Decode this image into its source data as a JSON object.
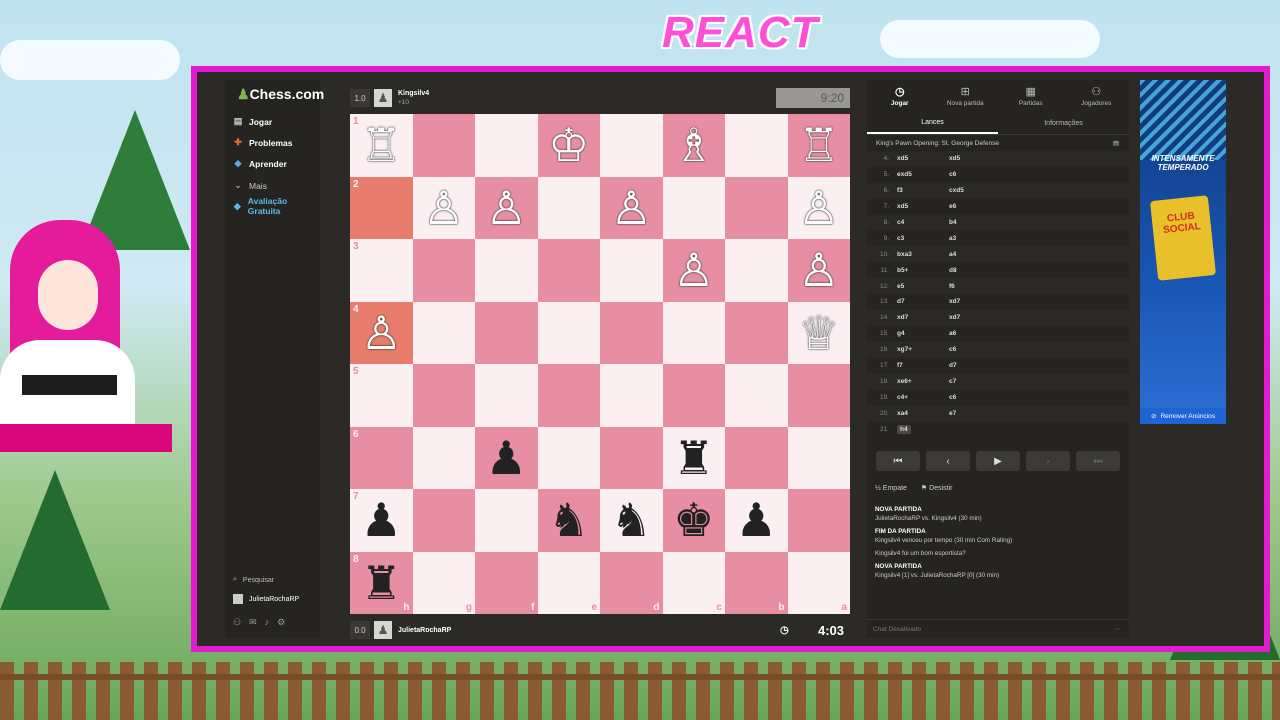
{
  "overlay": {
    "title": "REACT"
  },
  "nav": {
    "logo": "Chess.com",
    "items": [
      {
        "label": "Jogar",
        "icon": "play-icon"
      },
      {
        "label": "Problemas",
        "icon": "puzzle-icon"
      },
      {
        "label": "Aprender",
        "icon": "learn-icon"
      },
      {
        "label": "Mais",
        "icon": "chevron-down-icon"
      },
      {
        "label": "Avaliação Gratuita",
        "icon": "diamond-icon"
      }
    ],
    "search": "Pesquisar",
    "user": "JulietaRochaRP"
  },
  "top_player": {
    "score": "1.0",
    "name": "Kingsilv4",
    "sub": "+10",
    "clock": "9:20"
  },
  "bottom_player": {
    "score": "0.0",
    "name": "JulietaRochaRP",
    "clock": "4:03"
  },
  "board": {
    "ranks": [
      "1",
      "2",
      "3",
      "4",
      "5",
      "6",
      "7",
      "8"
    ],
    "files": [
      "h",
      "g",
      "f",
      "e",
      "d",
      "c",
      "b",
      "a"
    ],
    "pieces": {
      "0": {
        "0": "♖w",
        "3": "♔w",
        "5": "♗w",
        "7": "♖w"
      },
      "1": {
        "1": "♙w",
        "2": "♙w",
        "4": "♙w",
        "7": "♙w"
      },
      "2": {
        "5": "♙w",
        "7": "♙w"
      },
      "3": {
        "0": "♙w",
        "7": "♕w"
      },
      "5": {
        "2": "♟b",
        "5": "♜b"
      },
      "6": {
        "0": "♟b",
        "3": "♞b",
        "4": "♞b",
        "5": "♚b",
        "6": "♟b"
      },
      "7": {
        "0": "♜b"
      }
    },
    "highlights": [
      "1-0",
      "3-0"
    ]
  },
  "right": {
    "tabs": [
      {
        "label": "Jogar",
        "icon": "clock-icon"
      },
      {
        "label": "Nova partida",
        "icon": "plus-icon"
      },
      {
        "label": "Partidas",
        "icon": "board-icon"
      },
      {
        "label": "Jogadores",
        "icon": "players-icon"
      }
    ],
    "subtabs": [
      "Lances",
      "Informações"
    ],
    "opening": "King's Pawn Opening: St. George Defense",
    "moves": [
      {
        "n": "4.",
        "w": "xd5",
        "b": "xd5"
      },
      {
        "n": "5.",
        "w": "exd5",
        "b": "c6"
      },
      {
        "n": "6.",
        "w": "f3",
        "b": "cxd5"
      },
      {
        "n": "7.",
        "w": "xd5",
        "b": "e6"
      },
      {
        "n": "8.",
        "w": "c4",
        "b": "b4"
      },
      {
        "n": "9.",
        "w": "c3",
        "b": "a3"
      },
      {
        "n": "10.",
        "w": "bxa3",
        "b": "a4"
      },
      {
        "n": "11.",
        "w": "b5+",
        "b": "d8"
      },
      {
        "n": "12.",
        "w": "e5",
        "b": "f6"
      },
      {
        "n": "13.",
        "w": "d7",
        "b": "xd7"
      },
      {
        "n": "14.",
        "w": "xd7",
        "b": "xd7"
      },
      {
        "n": "15.",
        "w": "g4",
        "b": "a6"
      },
      {
        "n": "16.",
        "w": "xg7+",
        "b": "c6"
      },
      {
        "n": "17.",
        "w": "f7",
        "b": "d7"
      },
      {
        "n": "18.",
        "w": "xe6+",
        "b": "c7"
      },
      {
        "n": "19.",
        "w": "c4+",
        "b": "c6"
      },
      {
        "n": "20.",
        "w": "xa4",
        "b": "e7"
      },
      {
        "n": "21.",
        "w": "h4",
        "b": ""
      }
    ],
    "actions": [
      "Empate",
      "Desistir"
    ],
    "chat": [
      {
        "hd": "NOVA PARTIDA",
        "txt": "JulietaRochaRP vs. Kingsilv4 (30 min)"
      },
      {
        "hd": "FIM DA PARTIDA",
        "txt": "Kingsilv4 venceu por tempo (30 min Com Rating)"
      },
      {
        "hd": "",
        "txt": "Kingsilv4 foi um bom esportista?"
      },
      {
        "hd": "NOVA PARTIDA",
        "txt": "Kingsilv4 [1] vs. JulietaRochaRP [0] (30 min)"
      }
    ],
    "chat_disabled": "Chat Desativado"
  },
  "ad": {
    "headline": "INTENSAMENTE TEMPERADO",
    "brand": "CLUB SOCIAL",
    "remove": "Remover Anúncios"
  }
}
